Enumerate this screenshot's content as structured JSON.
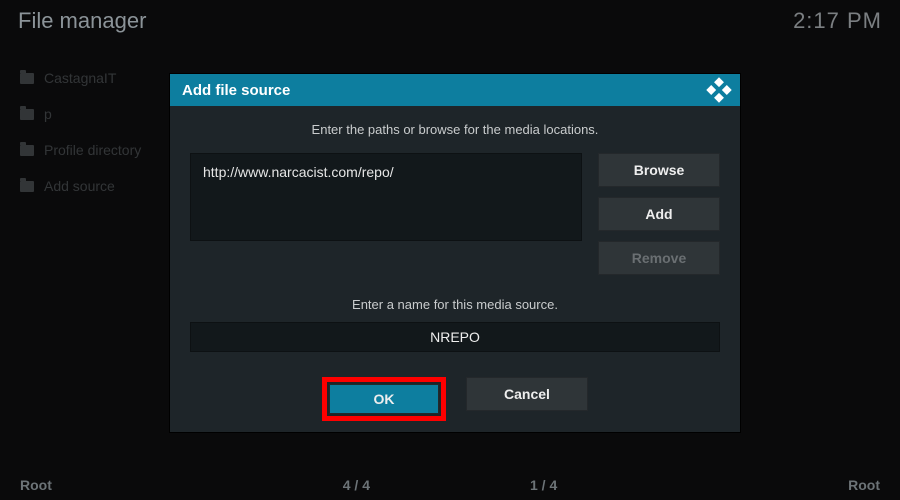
{
  "header": {
    "title": "File manager",
    "clock": "2:17 PM"
  },
  "sidebar": {
    "items": [
      {
        "label": "CastagnaIT"
      },
      {
        "label": "p"
      },
      {
        "label": "Profile directory"
      },
      {
        "label": "Add source"
      }
    ]
  },
  "bottom": {
    "left": "Root",
    "pos1": "4 / 4",
    "pos2": "1 / 4",
    "right": "Root"
  },
  "dialog": {
    "title": "Add file source",
    "hint_paths": "Enter the paths or browse for the media locations.",
    "path_value": "http://www.narcacist.com/repo/",
    "browse_label": "Browse",
    "add_label": "Add",
    "remove_label": "Remove",
    "hint_name": "Enter a name for this media source.",
    "name_value": "NREPO",
    "ok_label": "OK",
    "cancel_label": "Cancel"
  }
}
